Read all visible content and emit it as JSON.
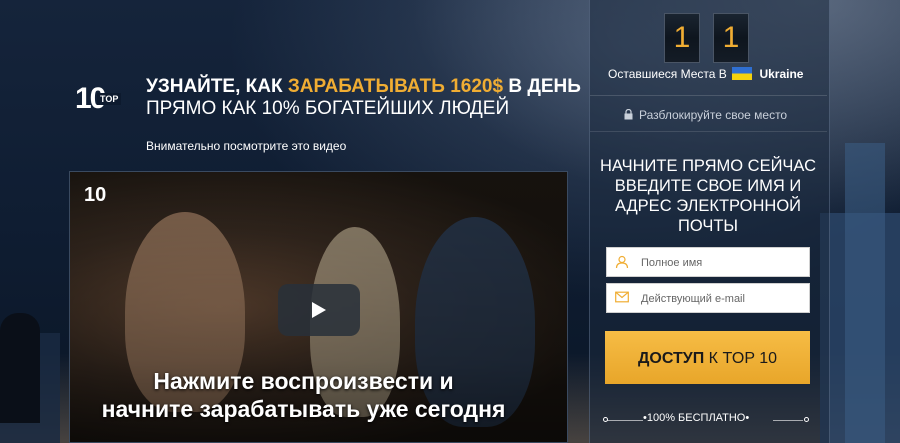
{
  "headline": {
    "line1_prefix": "УЗНАЙТЕ, КАК ",
    "line1_accent": "ЗАРАБАТЫВАТЬ 1620$",
    "line1_suffix": " В ДЕНЬ",
    "line2": "ПРЯМО КАК 10% БОГАТЕЙШИХ ЛЮДЕЙ"
  },
  "logo": {
    "number": "10",
    "tag": "TOP"
  },
  "watch_text": "Внимательно посмотрите это видео",
  "video": {
    "logo": "10",
    "caption_line1": "Нажмите воспроизвести и",
    "caption_line2": "начните зарабатывать уже сегодня",
    "play_icon": "play-icon"
  },
  "counter": {
    "digit1": "1",
    "digit2": "1"
  },
  "seats": {
    "label": "Оставшиеся Места В",
    "country": "Ukraine"
  },
  "unlock_text": "Разблокируйте свое место",
  "cta_text": "НАЧНИТЕ ПРЯМО СЕЙЧАС ВВЕДИТЕ СВОЕ ИМЯ И АДРЕС ЭЛЕКТРОННОЙ ПОЧТЫ",
  "form": {
    "name_placeholder": "Полное имя",
    "email_placeholder": "Действующий e-mail",
    "button_bold": "ДОСТУП",
    "button_rest": " К TOP 10"
  },
  "free_text": "•100% БЕСПЛАТНО•",
  "colors": {
    "accent": "#f0ad33",
    "button": "#f6bc45"
  }
}
